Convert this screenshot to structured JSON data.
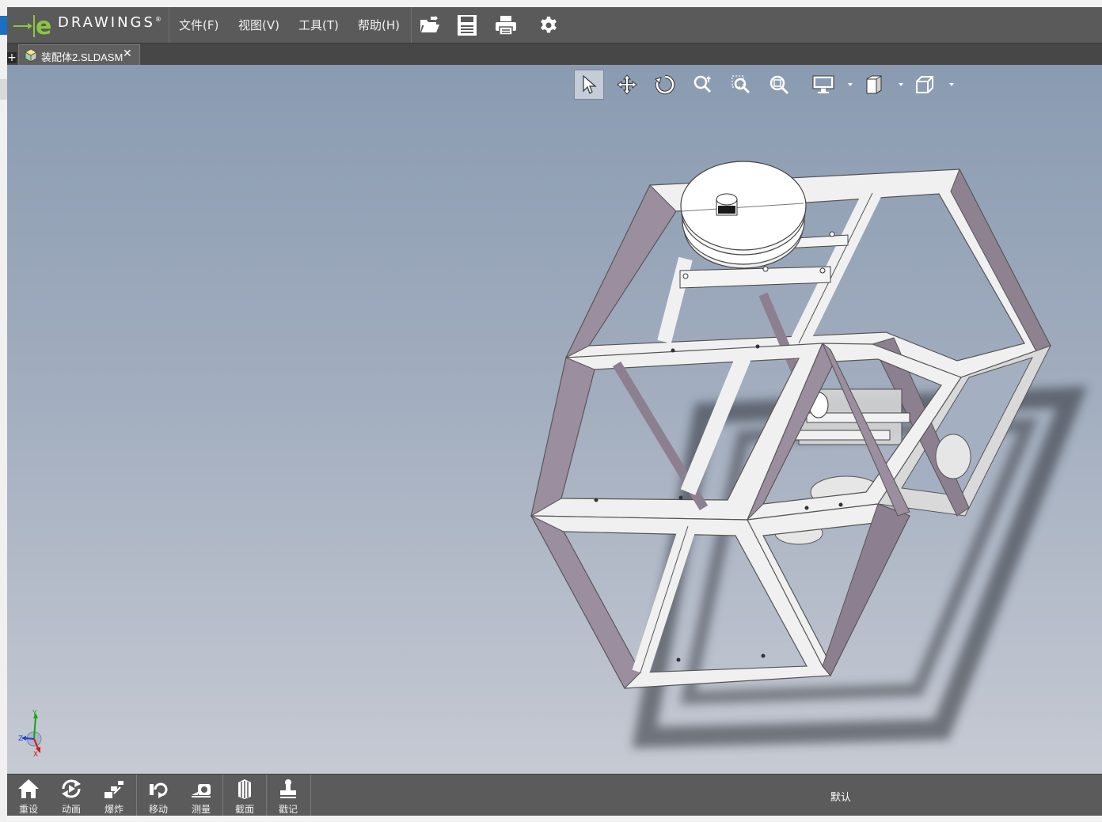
{
  "app": {
    "logo_text": "DRAWINGS",
    "logo_mark": "e",
    "logo_registered": "®"
  },
  "menu": {
    "items": [
      {
        "label": "文件(F)"
      },
      {
        "label": "视图(V)"
      },
      {
        "label": "工具(T)"
      },
      {
        "label": "帮助(H)"
      }
    ]
  },
  "toolbar": {
    "buttons": [
      {
        "icon": "open-folder-icon"
      },
      {
        "icon": "save-icon"
      },
      {
        "icon": "print-icon"
      },
      {
        "icon": "settings-gear-icon"
      }
    ]
  },
  "tabs": {
    "add_label": "+",
    "active": {
      "label": "装配体2.SLDASM",
      "close": "✕",
      "icon": "assembly-icon"
    }
  },
  "view_toolbar": {
    "buttons": [
      {
        "icon": "select-arrow-icon",
        "active": true
      },
      {
        "icon": "pan-icon"
      },
      {
        "icon": "rotate-icon"
      },
      {
        "icon": "zoom-icon"
      },
      {
        "icon": "zoom-to-area-icon"
      },
      {
        "icon": "zoom-to-fit-icon"
      },
      {
        "icon": "display-mode-icon",
        "dropdown": true
      },
      {
        "icon": "section-view-icon",
        "dropdown": true
      },
      {
        "icon": "standard-views-icon",
        "dropdown": true
      }
    ]
  },
  "triad": {
    "x": "X",
    "y": "Y",
    "z": "Z"
  },
  "bottom_bar": {
    "buttons": [
      {
        "label": "重设",
        "icon": "home-reset-icon"
      },
      {
        "label": "动画",
        "icon": "animate-icon"
      },
      {
        "label": "爆炸",
        "icon": "explode-icon"
      },
      {
        "label": "移动",
        "icon": "move-icon"
      },
      {
        "label": "测量",
        "icon": "measure-icon"
      },
      {
        "label": "截面",
        "icon": "section-icon"
      },
      {
        "label": "戳记",
        "icon": "stamp-icon"
      }
    ],
    "configuration": "默认"
  },
  "colors": {
    "menubar": "#5a5a5a",
    "tabbar": "#474747",
    "logo_green": "#8cc63f",
    "viewport_top": "#8a9bb1",
    "viewport_bottom": "#c6cad3",
    "frame_face": "#f1f1f1",
    "frame_side": "#9c8f9e"
  }
}
